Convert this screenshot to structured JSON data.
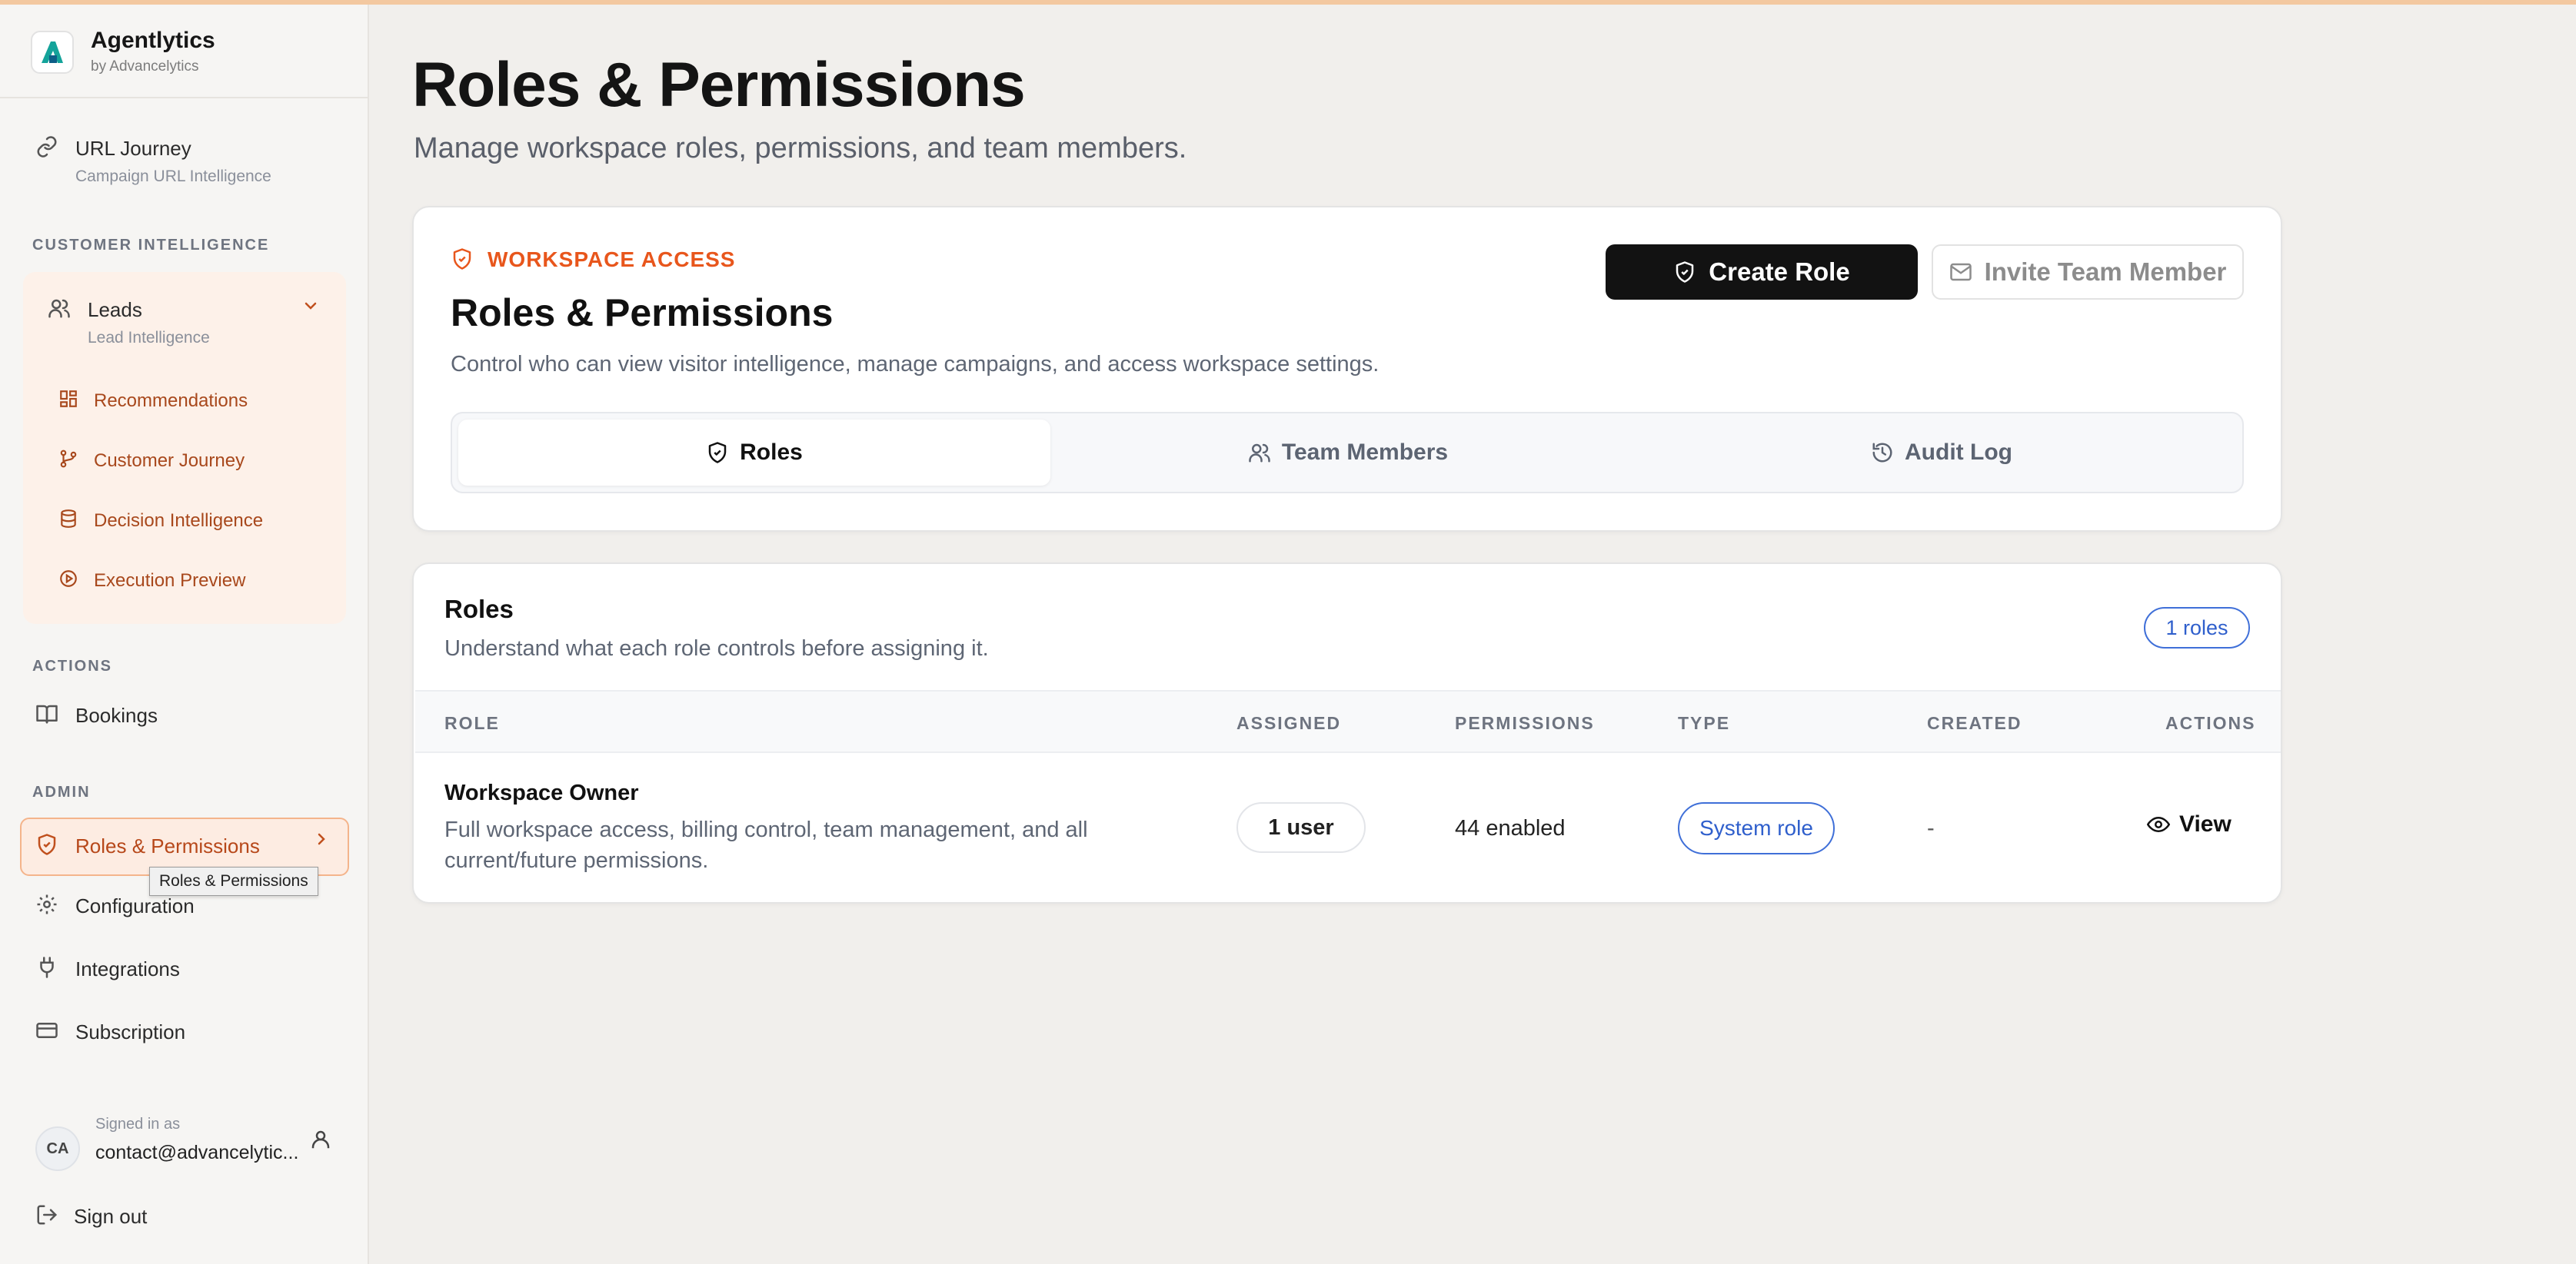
{
  "brand": {
    "name": "Agentlytics",
    "sub": "by Advancelytics"
  },
  "sidebar": {
    "url_journey": {
      "label": "URL Journey",
      "sub": "Campaign URL Intelligence"
    },
    "section_customer": "CUSTOMER INTELLIGENCE",
    "leads": {
      "label": "Leads",
      "sub": "Lead Intelligence"
    },
    "ci_items": [
      {
        "label": "Recommendations",
        "icon": "dashboard-icon"
      },
      {
        "label": "Customer Journey",
        "icon": "git-branch-icon"
      },
      {
        "label": "Decision Intelligence",
        "icon": "database-icon"
      },
      {
        "label": "Execution Preview",
        "icon": "play-circle-icon"
      }
    ],
    "section_actions": "ACTIONS",
    "bookings": "Bookings",
    "section_admin": "ADMIN",
    "roles": "Roles & Permissions",
    "tooltip": "Roles & Permissions",
    "configuration": "Configuration",
    "integrations": "Integrations",
    "subscription": "Subscription",
    "user": {
      "initials": "CA",
      "signed_in_label": "Signed in as",
      "email": "contact@advancelytic..."
    },
    "sign_out": "Sign out"
  },
  "header": {
    "title": "Roles & Permissions",
    "subtitle": "Manage workspace roles, permissions, and team members."
  },
  "access_card": {
    "eyebrow": "WORKSPACE ACCESS",
    "title": "Roles & Permissions",
    "description": "Control who can view visitor intelligence, manage campaigns, and access workspace settings.",
    "create_button": "Create Role",
    "invite_button": "Invite Team Member",
    "tabs": [
      {
        "label": "Roles",
        "active": true
      },
      {
        "label": "Team Members",
        "active": false
      },
      {
        "label": "Audit Log",
        "active": false
      }
    ]
  },
  "roles_card": {
    "title": "Roles",
    "description": "Understand what each role controls before assigning it.",
    "count_badge": "1 roles",
    "columns": [
      "ROLE",
      "ASSIGNED",
      "PERMISSIONS",
      "TYPE",
      "CREATED",
      "ACTIONS"
    ],
    "rows": [
      {
        "name": "Workspace Owner",
        "description": "Full workspace access, billing control, team management, and all current/future permissions.",
        "assigned": "1 user",
        "permissions": "44 enabled",
        "type": "System role",
        "created": "-",
        "action": "View"
      }
    ]
  },
  "colors": {
    "accent": "#e8561c",
    "primary": "#121212",
    "link": "#2f5fcc",
    "active_bg": "#fdece2"
  }
}
